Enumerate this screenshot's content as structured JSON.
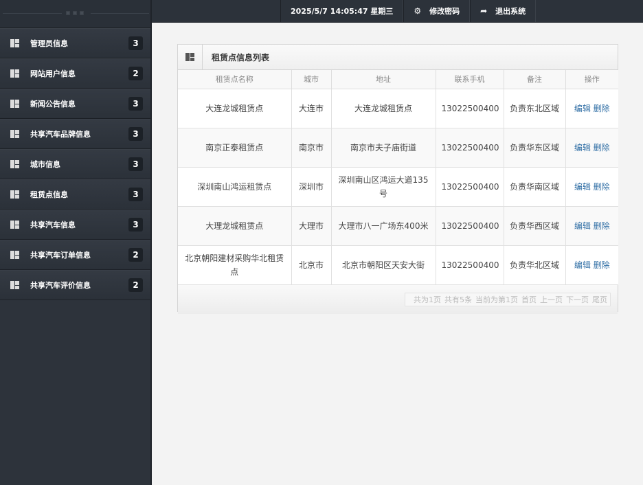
{
  "sidebar": {
    "items": [
      {
        "label": "管理员信息",
        "count": "3"
      },
      {
        "label": "网站用户信息",
        "count": "2"
      },
      {
        "label": "新闻公告信息",
        "count": "3"
      },
      {
        "label": "共享汽车品牌信息",
        "count": "3"
      },
      {
        "label": "城市信息",
        "count": "3"
      },
      {
        "label": "租赁点信息",
        "count": "3"
      },
      {
        "label": "共享汽车信息",
        "count": "3"
      },
      {
        "label": "共享汽车订单信息",
        "count": "2"
      },
      {
        "label": "共享汽车评价信息",
        "count": "2"
      }
    ]
  },
  "topbar": {
    "datetime": "2025/5/7 14:05:47 星期三",
    "change_password": "修改密码",
    "logout": "退出系统"
  },
  "panel": {
    "title": "租赁点信息列表",
    "columns": [
      "租赁点名称",
      "城市",
      "地址",
      "联系手机",
      "备注",
      "操作"
    ],
    "rows": [
      {
        "name": "大连龙城租赁点",
        "city": "大连市",
        "address": "大连龙城租赁点",
        "phone": "13022500400",
        "note": "负责东北区域"
      },
      {
        "name": "南京正泰租赁点",
        "city": "南京市",
        "address": "南京市夫子庙街道",
        "phone": "13022500400",
        "note": "负责华东区域"
      },
      {
        "name": "深圳南山鸿运租赁点",
        "city": "深圳市",
        "address": "深圳南山区鸿运大道135号",
        "phone": "13022500400",
        "note": "负责华南区域"
      },
      {
        "name": "大理龙城租赁点",
        "city": "大理市",
        "address": "大理市八一广场东400米",
        "phone": "13022500400",
        "note": "负责华西区域"
      },
      {
        "name": "北京朝阳建材采购华北租赁点",
        "city": "北京市",
        "address": "北京市朝阳区天安大街",
        "phone": "13022500400",
        "note": "负责华北区域"
      }
    ],
    "edit": "编辑",
    "delete": "删除",
    "pager": [
      "共为1页",
      "共有5条",
      "当前为第1页",
      "首页",
      "上一页",
      "下一页",
      "尾页"
    ]
  }
}
